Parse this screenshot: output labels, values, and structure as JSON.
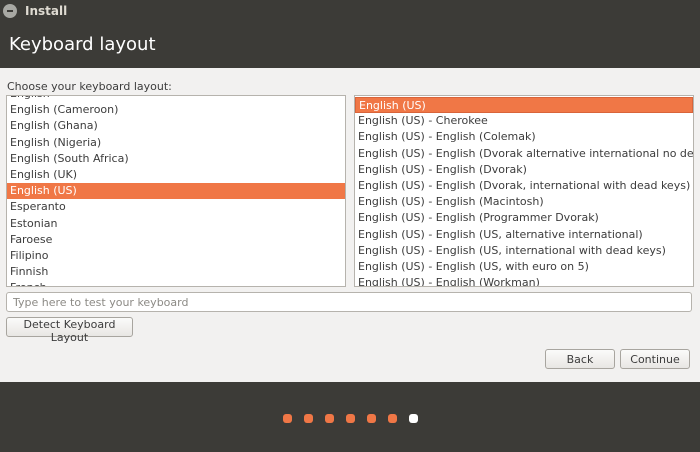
{
  "window": {
    "title": "Install"
  },
  "header": {
    "title": "Keyboard layout"
  },
  "main": {
    "prompt": "Choose your keyboard layout:",
    "layouts": {
      "items": [
        "English",
        "English (Cameroon)",
        "English (Ghana)",
        "English (Nigeria)",
        "English (South Africa)",
        "English (UK)",
        "English (US)",
        "Esperanto",
        "Estonian",
        "Faroese",
        "Filipino",
        "Finnish",
        "French"
      ],
      "selected_index": 6
    },
    "variants": {
      "items": [
        "English (US)",
        "English (US) - Cherokee",
        "English (US) - English (Colemak)",
        "English (US) - English (Dvorak alternative international no dead keys)",
        "English (US) - English (Dvorak)",
        "English (US) - English (Dvorak, international with dead keys)",
        "English (US) - English (Macintosh)",
        "English (US) - English (Programmer Dvorak)",
        "English (US) - English (US, alternative international)",
        "English (US) - English (US, international with dead keys)",
        "English (US) - English (US, with euro on 5)",
        "English (US) - English (Workman)"
      ],
      "selected_index": 0
    },
    "test_input": {
      "value": "",
      "placeholder": "Type here to test your keyboard"
    },
    "detect_button": "Detect Keyboard Layout"
  },
  "nav": {
    "back": "Back",
    "continue": "Continue"
  },
  "progress": {
    "total_steps": 7,
    "current_step": 7
  },
  "colors": {
    "accent": "#f07746",
    "dark": "#3c3b37",
    "done_dot": "#f07746",
    "current_dot": "#ffffff"
  }
}
